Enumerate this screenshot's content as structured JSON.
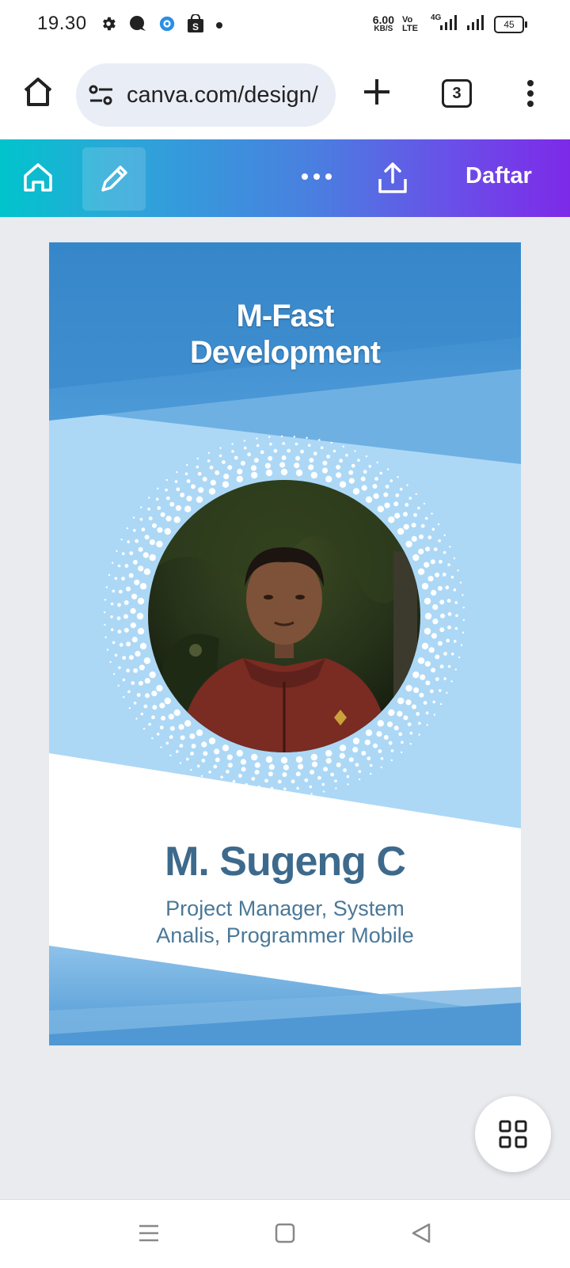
{
  "status_bar": {
    "time": "19.30",
    "net_speed_value": "6.00",
    "net_speed_unit": "KB/S",
    "volte": "Vo LTE",
    "network": "4G",
    "battery": "45"
  },
  "browser": {
    "url": "canva.com/design/",
    "tab_count": "3"
  },
  "canva_toolbar": {
    "register_label": "Daftar"
  },
  "design": {
    "title_line1": "M-Fast",
    "title_line2": "Development",
    "name": "M. Sugeng C",
    "role_line1": "Project Manager, System",
    "role_line2": "Analis, Programmer Mobile"
  },
  "colors": {
    "canva_gradient_start": "#00c4cc",
    "canva_gradient_end": "#7d2ae8",
    "design_blue_dark": "#3a87c9",
    "design_blue_light": "#acd8f6",
    "name_text": "#3d6a8c"
  }
}
